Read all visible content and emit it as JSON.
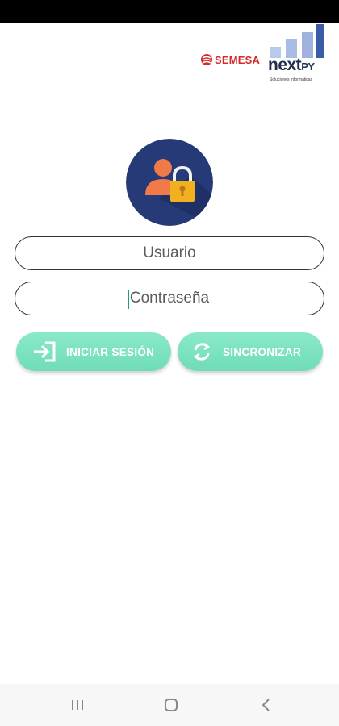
{
  "brand": {
    "semesa": "SEMESA",
    "nextpy_main": "next",
    "nextpy_suffix": "PY",
    "nextpy_tagline": "Soluciones Informáticas"
  },
  "login": {
    "username_placeholder": "Usuario",
    "password_placeholder": "Contraseña"
  },
  "buttons": {
    "login_label": "INICIAR SESIÓN",
    "sync_label": "SINCRONIZAR"
  },
  "colors": {
    "accent": "#6fdcb8",
    "avatar_bg": "#273a78",
    "lock": "#f2b01e",
    "person": "#f07a4a",
    "semesa_red": "#d42a2a"
  },
  "icons": {
    "login": "login-arrow-icon",
    "sync": "sync-icon",
    "avatar": "user-lock-icon",
    "nav_recent": "recent-apps-icon",
    "nav_home": "home-icon",
    "nav_back": "back-icon"
  }
}
